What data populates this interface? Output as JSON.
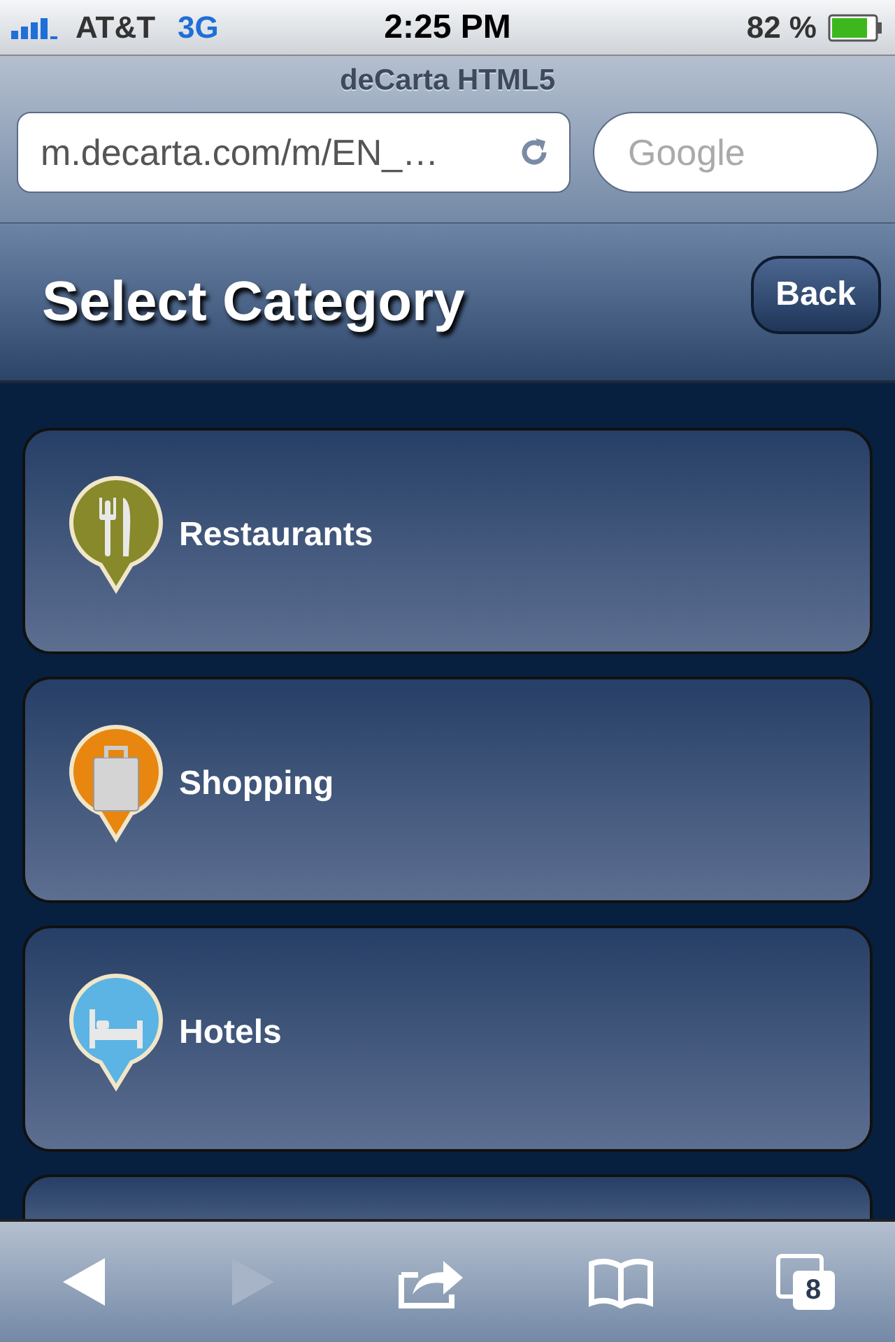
{
  "status_bar": {
    "carrier": "AT&T",
    "network": "3G",
    "time": "2:25 PM",
    "battery_percent": "82 %"
  },
  "browser": {
    "page_title": "deCarta HTML5",
    "url": "m.decarta.com/m/EN_…",
    "search": {
      "placeholder": "Google"
    }
  },
  "header": {
    "title": "Select Category",
    "back_button": "Back"
  },
  "categories": [
    {
      "label": "Restaurants",
      "kind": "restaurant",
      "color": "#87892a"
    },
    {
      "label": "Shopping",
      "kind": "shopping",
      "color": "#e8860f"
    },
    {
      "label": "Hotels",
      "kind": "hotel",
      "color": "#5bb4e3"
    }
  ],
  "toolbar": {
    "back_disabled": false,
    "forward_disabled": true,
    "tab_count": "8"
  }
}
